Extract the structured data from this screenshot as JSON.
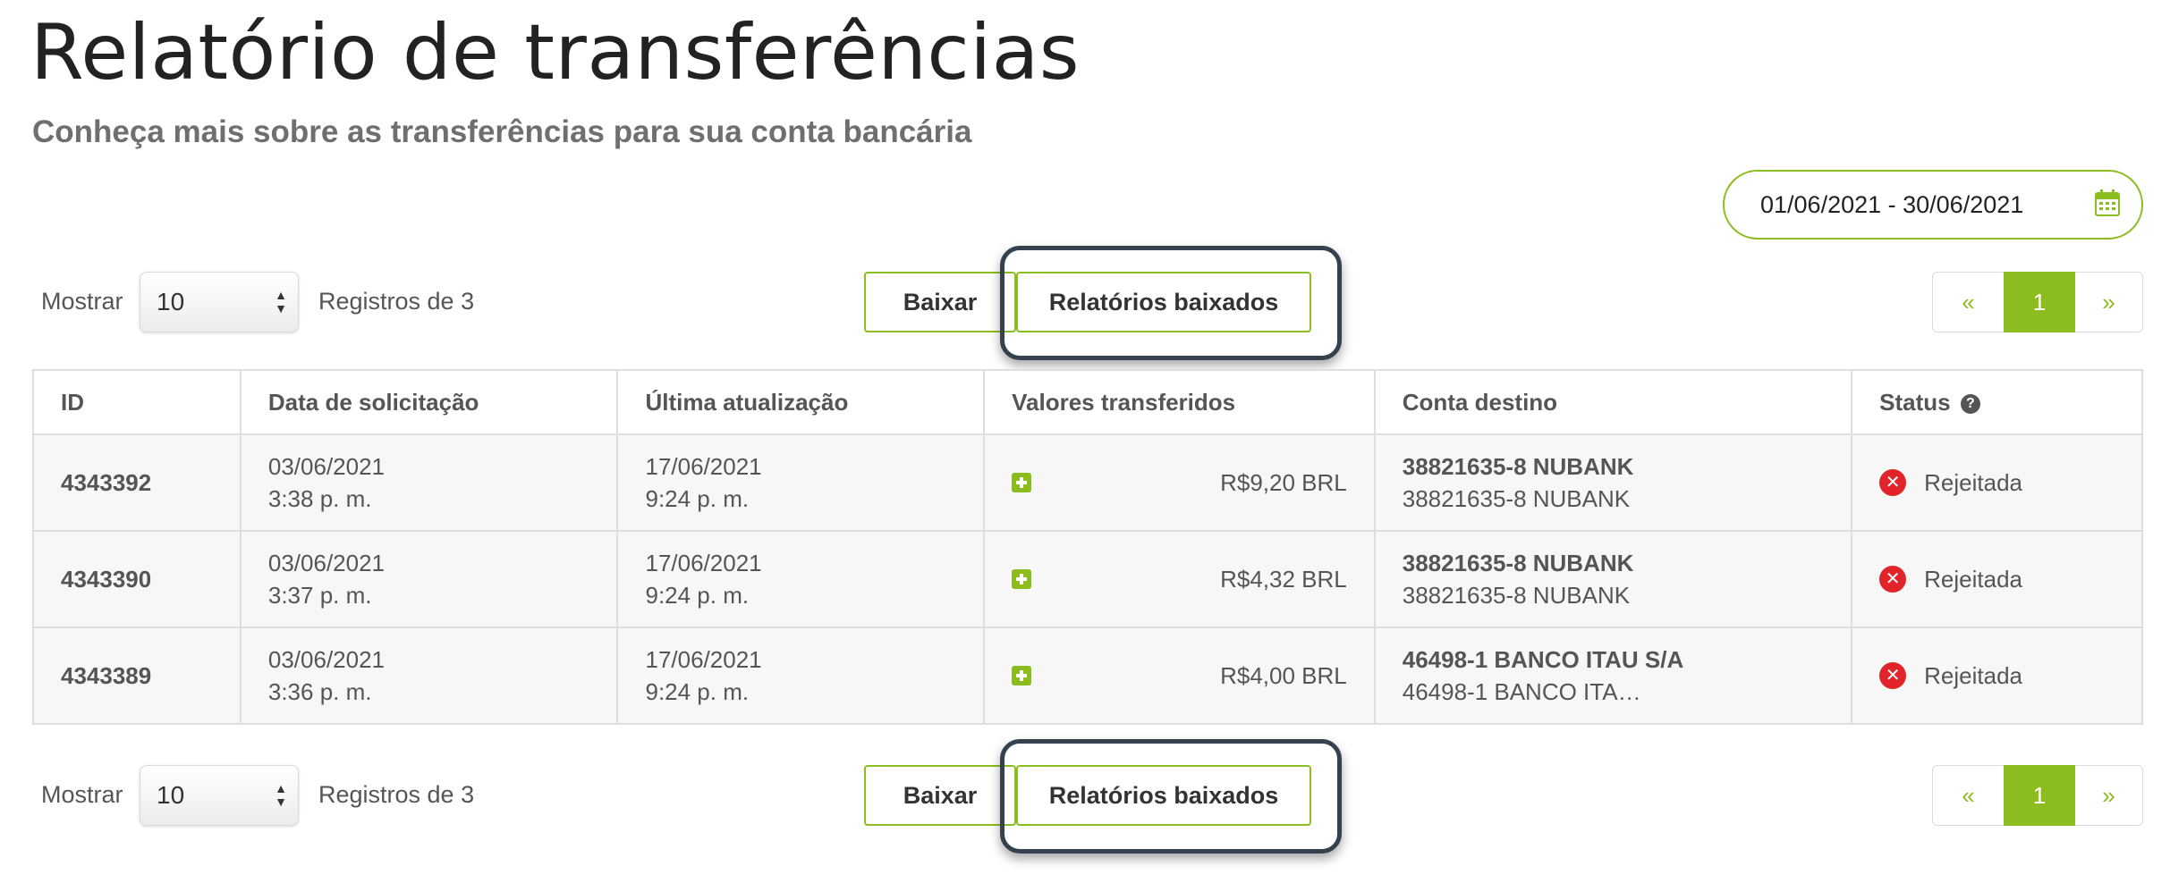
{
  "header": {
    "title": "Relatório de transferências",
    "subtitle": "Conheça mais sobre as transferências para sua conta bancária"
  },
  "date_filter": {
    "value": "01/06/2021 - 30/06/2021",
    "icon": "calendar-icon"
  },
  "controls": {
    "show_label": "Mostrar",
    "page_size": "10",
    "records_label": "Registros de 3",
    "download_button": "Baixar",
    "downloaded_reports_button": "Relatórios baixados",
    "pagination": {
      "prev": "«",
      "current": "1",
      "next": "»"
    }
  },
  "table": {
    "columns": [
      "ID",
      "Data de solicitação",
      "Última atualização",
      "Valores transferidos",
      "Conta destino",
      "Status"
    ],
    "rows": [
      {
        "id": "4343392",
        "request_date": "03/06/2021",
        "request_time": "3:38 p. m.",
        "update_date": "17/06/2021",
        "update_time": "9:24 p. m.",
        "amount": "R$9,20 BRL",
        "account_title": "38821635-8 NUBANK",
        "account_sub": "38821635-8 NUBANK",
        "status": "Rejeitada"
      },
      {
        "id": "4343390",
        "request_date": "03/06/2021",
        "request_time": "3:37 p. m.",
        "update_date": "17/06/2021",
        "update_time": "9:24 p. m.",
        "amount": "R$4,32 BRL",
        "account_title": "38821635-8 NUBANK",
        "account_sub": "38821635-8 NUBANK",
        "status": "Rejeitada"
      },
      {
        "id": "4343389",
        "request_date": "03/06/2021",
        "request_time": "3:36 p. m.",
        "update_date": "17/06/2021",
        "update_time": "9:24 p. m.",
        "amount": "R$4,00 BRL",
        "account_title": "46498-1 BANCO ITAU S/A",
        "account_sub": "46498-1 BANCO ITA…",
        "status": "Rejeitada"
      }
    ]
  },
  "colors": {
    "accent": "#8cbd1f",
    "reject": "#e0242a",
    "highlight_border": "#34414f"
  }
}
